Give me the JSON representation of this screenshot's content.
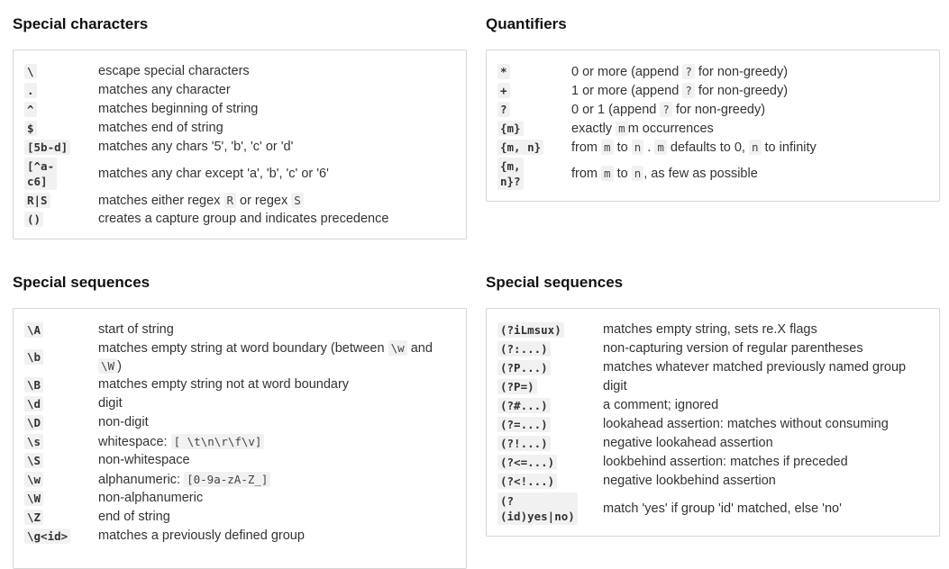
{
  "special_characters": {
    "title": "Special characters",
    "rows": [
      {
        "key": "\\",
        "desc": "escape special characters"
      },
      {
        "key": ".",
        "desc": "matches any character"
      },
      {
        "key": "^",
        "desc": "matches beginning of string"
      },
      {
        "key": "$",
        "desc": "matches end of string"
      },
      {
        "key": "[5b-d]",
        "desc": "matches any chars '5', 'b', 'c' or 'd'"
      },
      {
        "key1": "[^a-",
        "key2": "c6]",
        "desc": "matches any char except 'a', 'b', 'c' or '6'"
      },
      {
        "key": "R|S",
        "d1": "matches either regex",
        "c1": "R",
        "d2": "or regex",
        "c2": "S"
      },
      {
        "key": "()",
        "desc": "creates a capture group and indicates precedence"
      }
    ]
  },
  "quantifiers": {
    "title": "Quantifiers",
    "rows": [
      {
        "key": "*",
        "d1": "0 or more (append",
        "c1": "?",
        "d2": "for non-greedy)"
      },
      {
        "key": "+",
        "d1": "1 or more (append",
        "c1": "?",
        "d2": "for non-greedy)"
      },
      {
        "key": "?",
        "d1": "0 or 1 (append",
        "c1": "?",
        "d2": "for non-greedy)"
      },
      {
        "key": "{m}",
        "d1": "exactly",
        "c1": "m",
        "d2": "m occurrences"
      },
      {
        "key": "{m, n}",
        "d1": "from",
        "c1": "m",
        "d2": "to",
        "c2": "n",
        "d3": ".",
        "c3": "m",
        "d4": "defaults to 0,",
        "c4": "n",
        "d5": "to infinity"
      },
      {
        "key1": "{m,",
        "key2": "n}?",
        "d1": "from",
        "c1": "m",
        "d2": "to",
        "c2": "n",
        "d3": ", as few as possible"
      }
    ]
  },
  "special_sequences_left": {
    "title": "Special sequences",
    "rows": [
      {
        "key": "\\A",
        "desc": "start of string"
      },
      {
        "key": "\\b",
        "d1": "matches empty string at word boundary (between",
        "c1": "\\w",
        "d2": "and",
        "c2": "\\W",
        "d3": ")"
      },
      {
        "key": "\\B",
        "desc": "matches empty string not at word boundary"
      },
      {
        "key": "\\d",
        "desc": "digit"
      },
      {
        "key": "\\D",
        "desc": "non-digit"
      },
      {
        "key": "\\s",
        "d1": "whitespace:",
        "c1": "[ \\t\\n\\r\\f\\v]"
      },
      {
        "key": "\\S",
        "desc": "non-whitespace"
      },
      {
        "key": "\\w",
        "d1": "alphanumeric:",
        "c1": "[0-9a-zA-Z_]"
      },
      {
        "key": "\\W",
        "desc": "non-alphanumeric"
      },
      {
        "key": "\\Z",
        "desc": "end of string"
      },
      {
        "key": "\\g<id>",
        "desc": "matches a previously defined group"
      }
    ]
  },
  "special_sequences_right": {
    "title": "Special sequences",
    "rows": [
      {
        "key": "(?iLmsux)",
        "desc": "matches empty string, sets re.X flags"
      },
      {
        "key": "(?:...)",
        "desc": "non-capturing version of regular parentheses"
      },
      {
        "key": "(?P...)",
        "desc": "matches whatever matched previously named group"
      },
      {
        "key": "(?P=)",
        "desc": "digit"
      },
      {
        "key": "(?#...)",
        "desc": "a comment; ignored"
      },
      {
        "key": "(?=...)",
        "desc": "lookahead assertion: matches without consuming"
      },
      {
        "key": "(?!...)",
        "desc": "negative lookahead assertion"
      },
      {
        "key": "(?<=...)",
        "desc": "lookbehind assertion: matches if preceded"
      },
      {
        "key": "(?<!...)",
        "desc": "negative lookbehind assertion"
      },
      {
        "key1": "(?",
        "key2": "(id)yes|no)",
        "desc": "match 'yes' if group 'id' matched, else 'no'"
      }
    ]
  }
}
